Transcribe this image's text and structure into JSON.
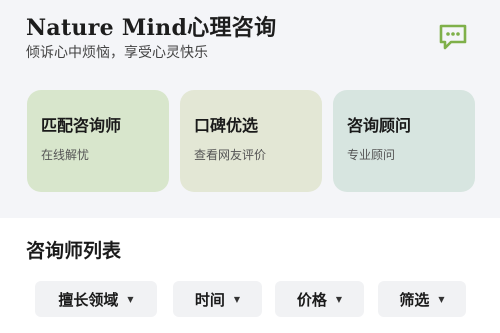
{
  "header": {
    "title_brand": "Nature Mind",
    "title_rest": "心理咨询",
    "subtitle": "倾诉心中烦恼，享受心灵快乐",
    "message_icon": "chat-bubble-icon",
    "accent_color": "#7fb04a"
  },
  "cards": [
    {
      "title": "匹配咨询师",
      "subtitle": "在线解忧",
      "color": "#d8e6cc"
    },
    {
      "title": "口碑优选",
      "subtitle": "查看网友评价",
      "color": "#e3e7d5"
    },
    {
      "title": "咨询顾问",
      "subtitle": "专业顾问",
      "color": "#d7e5e0"
    }
  ],
  "list": {
    "title": "咨询师列表",
    "filters": [
      {
        "label": "擅长领域"
      },
      {
        "label": "时间"
      },
      {
        "label": "价格"
      },
      {
        "label": "筛选"
      }
    ],
    "dropdown_icon": "caret-down-icon"
  }
}
